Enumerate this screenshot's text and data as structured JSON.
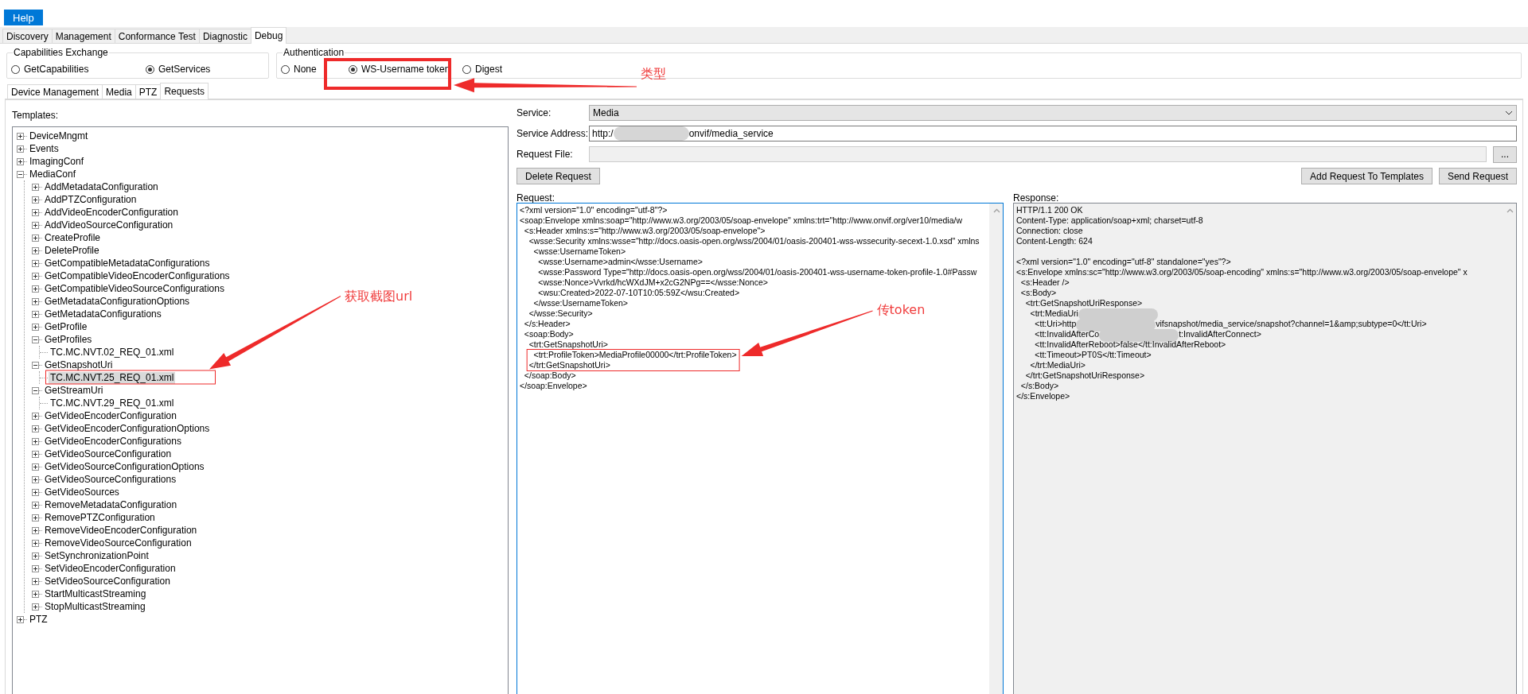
{
  "menu": [
    {
      "label": "Help",
      "selected": true
    }
  ],
  "main_tabs": [
    {
      "label": "Discovery",
      "selected": false
    },
    {
      "label": "Management",
      "selected": false
    },
    {
      "label": "Conformance Test",
      "selected": false
    },
    {
      "label": "Diagnostic",
      "selected": false
    },
    {
      "label": "Debug",
      "selected": true
    }
  ],
  "capabilities_exchange": {
    "title": "Capabilities Exchange",
    "options": [
      {
        "label": "GetCapabilities",
        "selected": false
      },
      {
        "label": "GetServices",
        "selected": true
      }
    ]
  },
  "authentication": {
    "title": "Authentication",
    "options": [
      {
        "label": "None",
        "selected": false
      },
      {
        "label": "WS-Username token",
        "selected": true
      },
      {
        "label": "Digest",
        "selected": false
      }
    ]
  },
  "sub_tabs": [
    {
      "label": "Device Management",
      "selected": false
    },
    {
      "label": "Media",
      "selected": false
    },
    {
      "label": "PTZ",
      "selected": false
    },
    {
      "label": "Requests",
      "selected": true
    }
  ],
  "templates": {
    "label": "Templates:",
    "tree": [
      {
        "label": "DeviceMngmt",
        "kind": "folder",
        "expanded": false,
        "selected": false
      },
      {
        "label": "Events",
        "kind": "folder",
        "expanded": false,
        "selected": false
      },
      {
        "label": "ImagingConf",
        "kind": "folder",
        "expanded": false,
        "selected": false
      },
      {
        "label": "MediaConf",
        "kind": "folder",
        "expanded": true,
        "selected": false,
        "children": [
          {
            "label": "AddMetadataConfiguration",
            "kind": "folder",
            "expanded": false,
            "selected": false
          },
          {
            "label": "AddPTZConfiguration",
            "kind": "folder",
            "expanded": false,
            "selected": false
          },
          {
            "label": "AddVideoEncoderConfiguration",
            "kind": "folder",
            "expanded": false,
            "selected": false
          },
          {
            "label": "AddVideoSourceConfiguration",
            "kind": "folder",
            "expanded": false,
            "selected": false
          },
          {
            "label": "CreateProfile",
            "kind": "folder",
            "expanded": false,
            "selected": false
          },
          {
            "label": "DeleteProfile",
            "kind": "folder",
            "expanded": false,
            "selected": false
          },
          {
            "label": "GetCompatibleMetadataConfigurations",
            "kind": "folder",
            "expanded": false,
            "selected": false
          },
          {
            "label": "GetCompatibleVideoEncoderConfigurations",
            "kind": "folder",
            "expanded": false,
            "selected": false
          },
          {
            "label": "GetCompatibleVideoSourceConfigurations",
            "kind": "folder",
            "expanded": false,
            "selected": false
          },
          {
            "label": "GetMetadataConfigurationOptions",
            "kind": "folder",
            "expanded": false,
            "selected": false
          },
          {
            "label": "GetMetadataConfigurations",
            "kind": "folder",
            "expanded": false,
            "selected": false
          },
          {
            "label": "GetProfile",
            "kind": "folder",
            "expanded": false,
            "selected": false
          },
          {
            "label": "GetProfiles",
            "kind": "folder",
            "expanded": true,
            "selected": false,
            "children": [
              {
                "label": "TC.MC.NVT.02_REQ_01.xml",
                "kind": "file",
                "selected": false
              }
            ]
          },
          {
            "label": "GetSnapshotUri",
            "kind": "folder",
            "expanded": true,
            "selected": false,
            "children": [
              {
                "label": "TC.MC.NVT.25_REQ_01.xml",
                "kind": "file",
                "selected": true
              }
            ]
          },
          {
            "label": "GetStreamUri",
            "kind": "folder",
            "expanded": true,
            "selected": false,
            "children": [
              {
                "label": "TC.MC.NVT.29_REQ_01.xml",
                "kind": "file",
                "selected": false
              }
            ]
          },
          {
            "label": "GetVideoEncoderConfiguration",
            "kind": "folder",
            "expanded": false,
            "selected": false
          },
          {
            "label": "GetVideoEncoderConfigurationOptions",
            "kind": "folder",
            "expanded": false,
            "selected": false
          },
          {
            "label": "GetVideoEncoderConfigurations",
            "kind": "folder",
            "expanded": false,
            "selected": false
          },
          {
            "label": "GetVideoSourceConfiguration",
            "kind": "folder",
            "expanded": false,
            "selected": false
          },
          {
            "label": "GetVideoSourceConfigurationOptions",
            "kind": "folder",
            "expanded": false,
            "selected": false
          },
          {
            "label": "GetVideoSourceConfigurations",
            "kind": "folder",
            "expanded": false,
            "selected": false
          },
          {
            "label": "GetVideoSources",
            "kind": "folder",
            "expanded": false,
            "selected": false
          },
          {
            "label": "RemoveMetadataConfiguration",
            "kind": "folder",
            "expanded": false,
            "selected": false
          },
          {
            "label": "RemovePTZConfiguration",
            "kind": "folder",
            "expanded": false,
            "selected": false
          },
          {
            "label": "RemoveVideoEncoderConfiguration",
            "kind": "folder",
            "expanded": false,
            "selected": false
          },
          {
            "label": "RemoveVideoSourceConfiguration",
            "kind": "folder",
            "expanded": false,
            "selected": false
          },
          {
            "label": "SetSynchronizationPoint",
            "kind": "folder",
            "expanded": false,
            "selected": false
          },
          {
            "label": "SetVideoEncoderConfiguration",
            "kind": "folder",
            "expanded": false,
            "selected": false
          },
          {
            "label": "SetVideoSourceConfiguration",
            "kind": "folder",
            "expanded": false,
            "selected": false
          },
          {
            "label": "StartMulticastStreaming",
            "kind": "folder",
            "expanded": false,
            "selected": false
          },
          {
            "label": "StopMulticastStreaming",
            "kind": "folder",
            "expanded": false,
            "selected": false
          }
        ]
      },
      {
        "label": "PTZ",
        "kind": "folder",
        "expanded": false,
        "selected": false
      }
    ]
  },
  "service": {
    "label": "Service:",
    "value": "Media"
  },
  "service_address": {
    "label": "Service Address:",
    "before": "http:/",
    "after": "onvif/media_service"
  },
  "request_file": {
    "label": "Request File:",
    "button": "..."
  },
  "buttons": {
    "delete": "Delete Request",
    "add": "Add Request To Templates",
    "send": "Send Request"
  },
  "request": {
    "label": "Request:",
    "lines": [
      {
        "kind": "text",
        "text": "<?xml version=\"1.0\" encoding=\"utf-8\"?>"
      },
      {
        "kind": "text",
        "text": "<soap:Envelope xmlns:soap=\"http://www.w3.org/2003/05/soap-envelope\" xmlns:trt=\"http://www.onvif.org/ver10/media/w"
      },
      {
        "kind": "text",
        "text": "  <s:Header xmlns:s=\"http://www.w3.org/2003/05/soap-envelope\">"
      },
      {
        "kind": "text",
        "text": "    <wsse:Security xmlns:wsse=\"http://docs.oasis-open.org/wss/2004/01/oasis-200401-wss-wssecurity-secext-1.0.xsd\" xmlns"
      },
      {
        "kind": "text",
        "text": "      <wsse:UsernameToken>"
      },
      {
        "kind": "text",
        "text": "        <wsse:Username>admin</wsse:Username>"
      },
      {
        "kind": "text",
        "text": "        <wsse:Password Type=\"http://docs.oasis-open.org/wss/2004/01/oasis-200401-wss-username-token-profile-1.0#Passw"
      },
      {
        "kind": "text",
        "text": "        <wsse:Nonce>Vvrkd/hcWXdJM+x2cG2NPg==</wsse:Nonce>"
      },
      {
        "kind": "text",
        "text": "        <wsu:Created>2022-07-10T10:05:59Z</wsu:Created>"
      },
      {
        "kind": "text",
        "text": "      </wsse:UsernameToken>"
      },
      {
        "kind": "text",
        "text": "    </wsse:Security>"
      },
      {
        "kind": "text",
        "text": "  </s:Header>"
      },
      {
        "kind": "text",
        "text": "  <soap:Body>"
      },
      {
        "kind": "text",
        "text": "    <trt:GetSnapshotUri>"
      },
      {
        "kind": "text",
        "text": "      <trt:ProfileToken>MediaProfile00000</trt:ProfileToken>"
      },
      {
        "kind": "text",
        "text": "    </trt:GetSnapshotUri>"
      },
      {
        "kind": "text",
        "text": "  </soap:Body>"
      },
      {
        "kind": "text",
        "text": "</soap:Envelope>"
      }
    ]
  },
  "response": {
    "label": "Response:",
    "headers": [
      {
        "kind": "text",
        "text": "HTTP/1.1 200 OK"
      },
      {
        "kind": "text",
        "text": "Content-Type: application/soap+xml; charset=utf-8"
      },
      {
        "kind": "text",
        "text": "Connection: close"
      },
      {
        "kind": "text",
        "text": "Content-Length: 624"
      }
    ],
    "body": [
      {
        "kind": "text",
        "text": "<?xml version=\"1.0\" encoding=\"utf-8\" standalone=\"yes\"?>"
      },
      {
        "kind": "text",
        "text": "<s:Envelope xmlns:sc=\"http://www.w3.org/2003/05/soap-encoding\" xmlns:s=\"http://www.w3.org/2003/05/soap-envelope\" x"
      },
      {
        "kind": "text",
        "text": "  <s:Header />"
      },
      {
        "kind": "text",
        "text": "  <s:Body>"
      },
      {
        "kind": "text",
        "text": "    <trt:GetSnapshotUriResponse>"
      },
      {
        "kind": "redacted",
        "before": "      <trt:MediaUri"
      },
      {
        "kind": "redacted",
        "before": "        <tt:Uri>http",
        "after": "vifsnapshot/media_service/snapshot?channel=1&amp;subtype=0</tt:Uri>"
      },
      {
        "kind": "redacted",
        "before": "        <tt:InvalidAfterCo",
        "after": "t:InvalidAfterConnect>"
      },
      {
        "kind": "text",
        "text": "        <tt:InvalidAfterReboot>false</tt:InvalidAfterReboot>"
      },
      {
        "kind": "text",
        "text": "        <tt:Timeout>PT0S</tt:Timeout>"
      },
      {
        "kind": "text",
        "text": "      </trt:MediaUri>"
      },
      {
        "kind": "text",
        "text": "    </trt:GetSnapshotUriResponse>"
      },
      {
        "kind": "text",
        "text": "  </s:Body>"
      },
      {
        "kind": "text",
        "text": "</s:Envelope>"
      }
    ]
  },
  "annotations": [
    {
      "label": "类型"
    },
    {
      "label": "获取截图url"
    },
    {
      "label": "传token"
    }
  ]
}
